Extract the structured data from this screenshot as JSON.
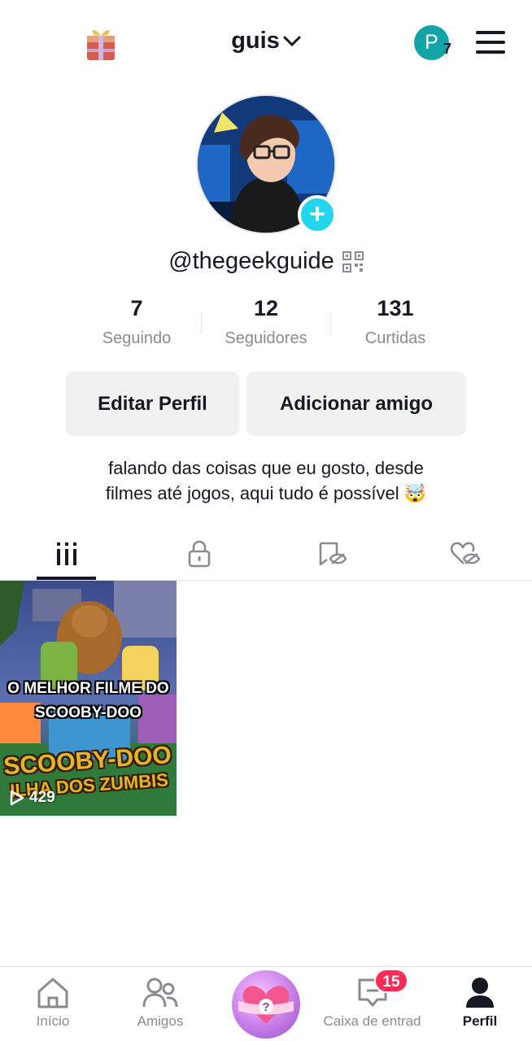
{
  "header": {
    "username": "guis",
    "notification_initial": "P",
    "notification_count": "7"
  },
  "profile": {
    "handle": "@thegeekguide",
    "stats": [
      {
        "value": "7",
        "label": "Seguindo"
      },
      {
        "value": "12",
        "label": "Seguidores"
      },
      {
        "value": "131",
        "label": "Curtidas"
      }
    ],
    "edit_button": "Editar Perfil",
    "add_friend_button": "Adicionar amigo",
    "bio_line1": "falando das coisas que eu gosto, desde",
    "bio_line2": "filmes até jogos, aqui tudo é possível 🤯"
  },
  "videos": [
    {
      "overlay_title_line1": "O MELHOR FILME DO",
      "overlay_title_line2": "SCOOBY-DOO",
      "poster_line1": "SCOOBY-DOO",
      "poster_line2": "ILHA DOS ZUMBIS",
      "views": "429"
    }
  ],
  "bottom_nav": {
    "home": "Início",
    "friends": "Amigos",
    "inbox": "Caixa de entrad",
    "inbox_badge": "15",
    "profile": "Perfil"
  },
  "colors": {
    "accent_teal": "#20d5ec",
    "badge_red": "#fe2c55",
    "text_primary": "#161823",
    "text_secondary": "#8a8b91"
  },
  "icons": {
    "gift": "gift-icon",
    "menu": "hamburger-menu-icon",
    "qr": "qr-code-icon",
    "tab_videos": "video-grid-icon",
    "tab_private": "lock-icon",
    "tab_reposts": "hidden-bookmark-icon",
    "tab_liked": "hidden-heart-icon"
  }
}
